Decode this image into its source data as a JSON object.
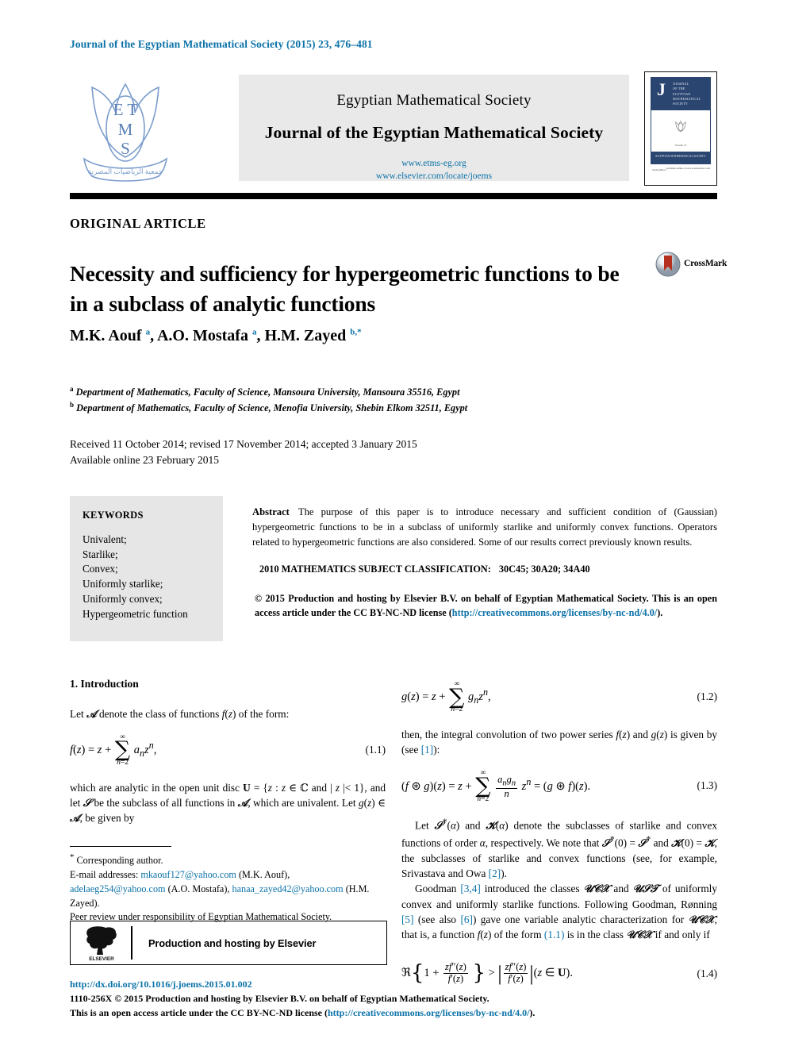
{
  "running_head": "Journal of the Egyptian Mathematical Society (2015) 23, 476–481",
  "masthead": {
    "logo_name": "etms-logo",
    "society": "Egyptian Mathematical Society",
    "journal_title": "Journal of the Egyptian Mathematical Society",
    "url1": "www.etms-eg.org",
    "url2": "www.elsevier.com/locate/joems",
    "cover": {
      "letter": "J",
      "lines": [
        "JOURNAL",
        "OF THE",
        "EGYPTIAN",
        "MATHEMATICAL",
        "SOCIETY"
      ],
      "caption": "Volume 23",
      "band_text": "EGYPTIAN MATHEMATICAL SOCIETY",
      "band_text2": "ETMS",
      "foot_left": "ScienceDirect",
      "foot_right": "Available online at www.sciencedirect.com"
    }
  },
  "article": {
    "type_label": "ORIGINAL ARTICLE",
    "title": "Necessity and sufficiency for hypergeometric functions to be in a subclass of analytic functions",
    "crossmark_label": "CrossMark",
    "authors_html": "M.K. Aouf <sup>a</sup>, A.O. Mostafa <sup>a</sup>, H.M. Zayed <sup>b,</sup><sup class=\"star\">*</sup>",
    "affiliations": [
      "Department of Mathematics, Faculty of Science, Mansoura University, Mansoura 35516, Egypt",
      "Department of Mathematics, Faculty of Science, Menofia University, Shebin Elkom 32511, Egypt"
    ],
    "affil_markers": [
      "a",
      "b"
    ],
    "dates_line1": "Received 11 October 2014; revised 17 November 2014; accepted 3 January 2015",
    "dates_line2": "Available online 23 February 2015"
  },
  "keywords": {
    "heading": "KEYWORDS",
    "items": [
      "Univalent;",
      "Starlike;",
      "Convex;",
      "Uniformly starlike;",
      "Uniformly convex;",
      "Hypergeometric function"
    ]
  },
  "abstract": {
    "label": "Abstract",
    "text": "The purpose of this paper is to introduce necessary and sufficient condition of (Gaussian) hypergeometric functions to be in a subclass of uniformly starlike and uniformly convex functions. Operators related to hypergeometric functions are also considered. Some of our results correct previously known results.",
    "msc_label": "2010 MATHEMATICS SUBJECT CLASSIFICATION:",
    "msc_codes": "30C45; 30A20; 34A40",
    "copyright_text": "© 2015 Production and hosting by Elsevier B.V. on behalf of Egyptian Mathematical Society. This is an open access article under the CC BY-NC-ND license (",
    "copyright_link": "http://creativecommons.org/licenses/by-nc-nd/4.0/",
    "copyright_tail": ")."
  },
  "body": {
    "section_heading": "1. Introduction",
    "left_p1": "Let ᴀ denote the class of functions f(z) of the form:",
    "eq_1_1_num": "(1.1)",
    "left_p2": "which are analytic in the open unit disc U = {z : z ∈ ℂ and | z |< 1}, and let 𝒮 be the subclass of all functions in 𝒜, which are univalent. Let g(z) ∈ 𝒜, be given by",
    "eq_1_2_num": "(1.2)",
    "right_p1": "then, the integral convolution of two power series f(z) and g(z) is given by (see [1]):",
    "right_p1_ref": "[1]",
    "eq_1_3_num": "(1.3)",
    "right_p2": "Let 𝒮*(α) and 𝒦(α) denote the subclasses of starlike and convex functions of order α, respectively. We note that 𝒮*(0) = 𝒮* and 𝒦(0) = 𝒦, the subclasses of starlike and convex functions (see, for example, Srivastava and Owa [2]).",
    "right_p3": "Goodman [3,4] introduced the classes 𝒰𝒞𝒱 and 𝒰𝒮𝒯 of uniformly convex and uniformly starlike functions. Following Goodman, Rønning [5] (see also [6]) gave one variable analytic characterization for 𝒰𝒞𝒱, that is, a function f(z) of the form (1.1) is in the class 𝒰𝒞𝒱 if and only if",
    "refs": {
      "r1": "[1]",
      "r2": "[2]",
      "r34": "[3,4]",
      "r5": "[5]",
      "r6": "[6]",
      "e11": "(1.1)"
    },
    "eq_1_4_num": "(1.4)"
  },
  "footnote": {
    "star": "*",
    "corresponding": "Corresponding author.",
    "email_label": "E-mail addresses:",
    "emails": [
      {
        "address": "mkaouf127@yahoo.com",
        "owner": "(M.K. Aouf)"
      },
      {
        "address": "adelaeg254@yahoo.com",
        "owner": "(A.O. Mostafa)"
      },
      {
        "address": "hanaa_zayed42@yahoo.com",
        "owner": "(H.M. Zayed)"
      }
    ],
    "peer_review": "Peer review under responsibility of Egyptian Mathematical Society."
  },
  "elsevier_box": {
    "logo_label": "ELSEVIER",
    "text": "Production and hosting by Elsevier"
  },
  "footer": {
    "doi": "http://dx.doi.org/10.1016/j.joems.2015.01.002",
    "line2": "1110-256X © 2015 Production and hosting by Elsevier B.V. on behalf of Egyptian Mathematical Society.",
    "line3_pre": "This is an open access article under the CC BY-NC-ND license (",
    "line3_link": "http://creativecommons.org/licenses/by-nc-nd/4.0/",
    "line3_post": ")."
  },
  "colors": {
    "link": "#0b72a8",
    "banner_bg": "#e9e9e9",
    "keywords_bg": "#e6e6e6",
    "cover_navy": "#2a4570",
    "crossmark_red": "#b5301f"
  }
}
